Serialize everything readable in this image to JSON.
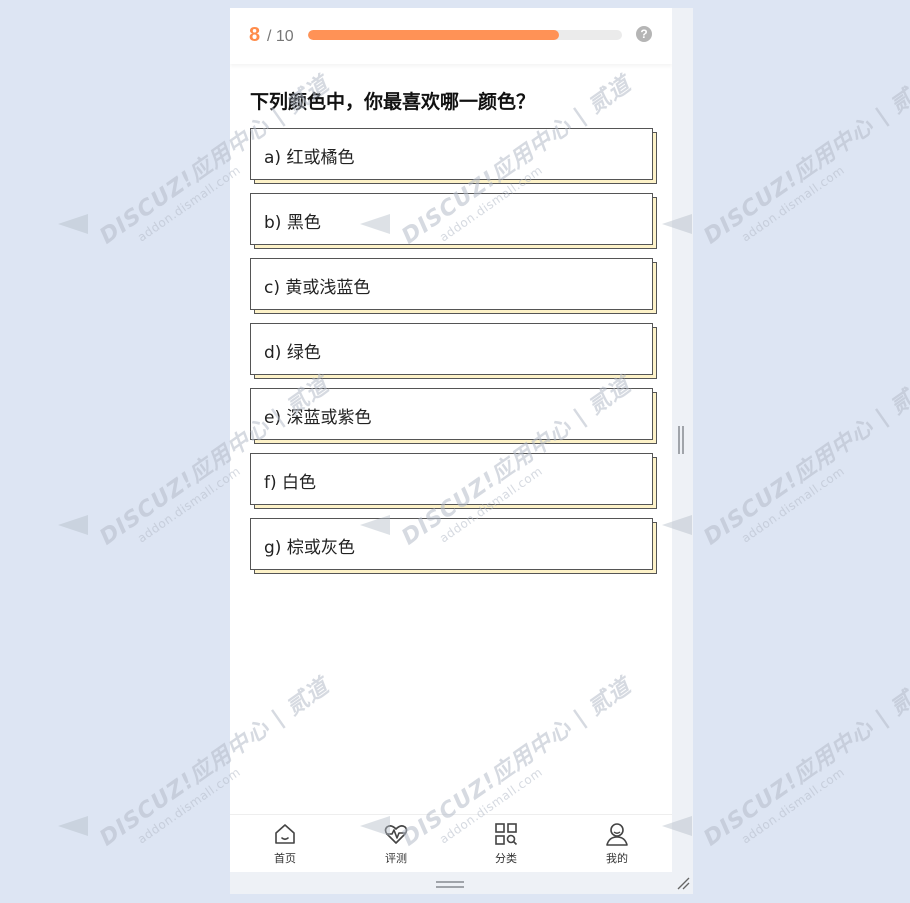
{
  "quiz": {
    "current": "8",
    "total": "/ 10",
    "progress": 0.8,
    "question": "下列颜色中，你最喜欢哪一颜色？",
    "help_icon": "?",
    "options": [
      {
        "label": "a) 红或橘色"
      },
      {
        "label": "b) 黑色"
      },
      {
        "label": "c) 黄或浅蓝色"
      },
      {
        "label": "d) 绿色"
      },
      {
        "label": "e) 深蓝或紫色"
      },
      {
        "label": "f) 白色"
      },
      {
        "label": "g) 棕或灰色"
      }
    ]
  },
  "bottom_nav": {
    "items": [
      {
        "label": "首页",
        "icon": "home-icon"
      },
      {
        "label": "评测",
        "icon": "heart-pulse-icon"
      },
      {
        "label": "分类",
        "icon": "category-search-icon"
      },
      {
        "label": "我的",
        "icon": "user-icon"
      }
    ]
  },
  "watermark": {
    "brand": "DISCUZ!应用中心",
    "site": "addon.dismall.com",
    "tag": "贰道"
  },
  "colors": {
    "accent": "#ff8c4b",
    "progress_fill": "#ff9256",
    "option_shadow": "#fdf2c8",
    "background": "#dde5f3"
  }
}
